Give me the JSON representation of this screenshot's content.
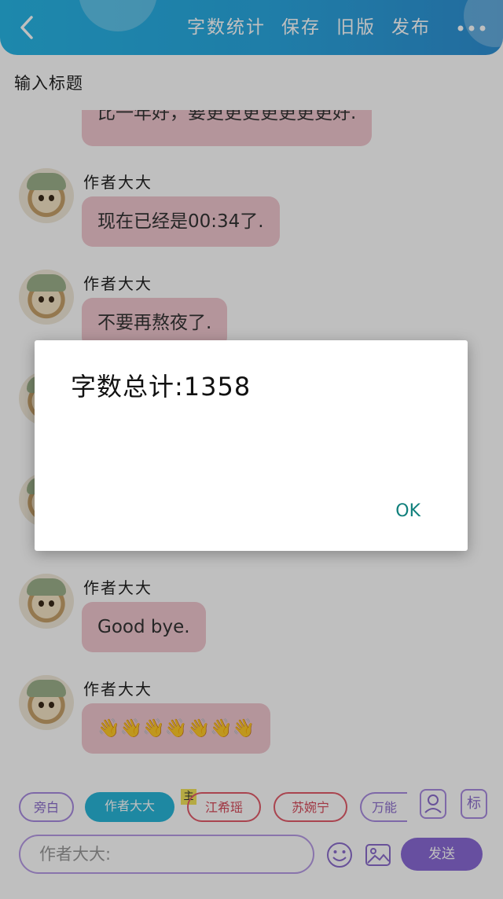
{
  "header": {
    "actions": [
      "字数统计",
      "保存",
      "旧版",
      "发布"
    ]
  },
  "title_placeholder": "输入标题",
  "messages": [
    {
      "name": "",
      "text": "比一年好，要更更更更更更更好."
    },
    {
      "name": "作者大大",
      "text": "现在已经是00:34了."
    },
    {
      "name": "作者大大",
      "text": "不要再熬夜了."
    },
    {
      "name": "作者大大",
      "text": "Good bye."
    },
    {
      "name": "作者大大",
      "text": "👋👋👋👋👋👋👋"
    }
  ],
  "roles": {
    "aside": "旁白",
    "author": "作者大大",
    "jiang": "江希瑶",
    "su": "苏婉宁",
    "wan": "万能",
    "main_badge": "主",
    "tag_label": "标"
  },
  "input": {
    "value": "作者大大:"
  },
  "send_label": "发送",
  "dialog": {
    "message": "字数总计:1358",
    "ok_label": "OK"
  },
  "colors": {
    "header_accent": "#2aa7e0",
    "bubble": "#f0c7cf",
    "send_button": "#8a6ad6",
    "ok_text": "#11807c"
  }
}
